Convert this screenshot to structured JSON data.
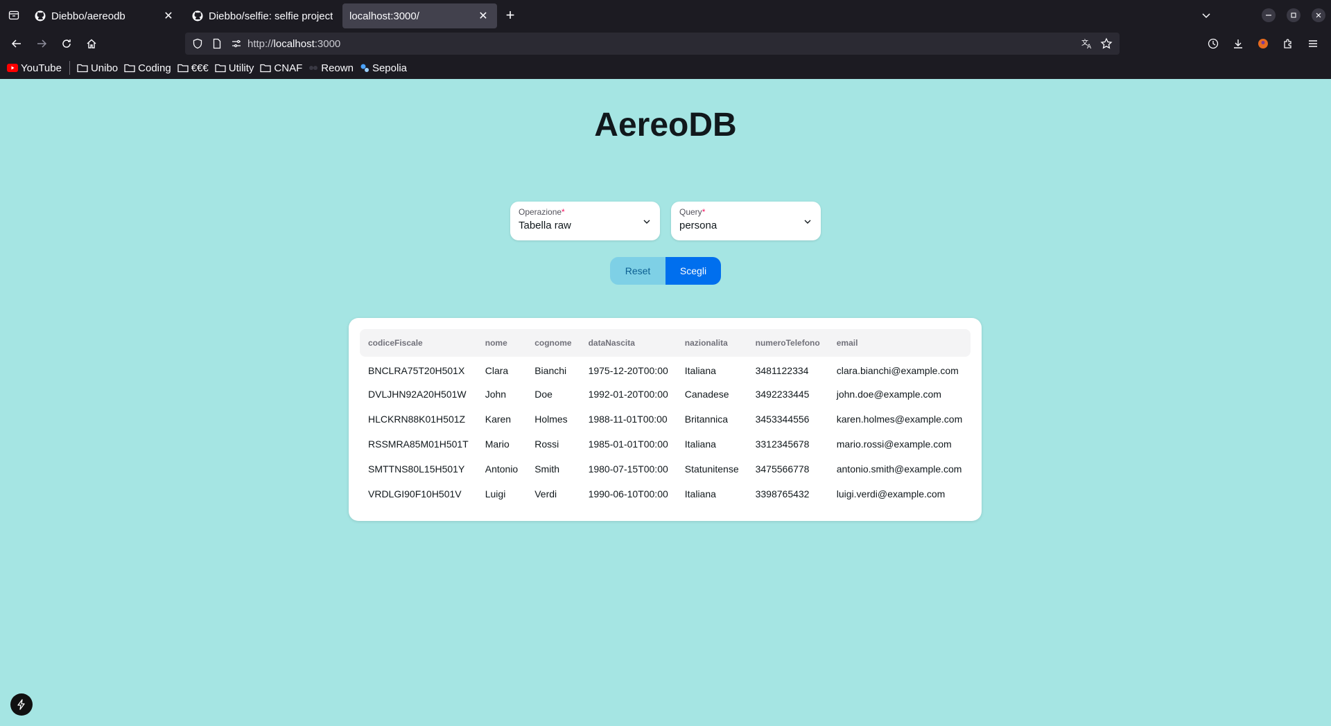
{
  "browser": {
    "tabs": [
      {
        "title": "Diebbo/aereodb",
        "icon": "github-icon"
      },
      {
        "title": "Diebbo/selfie: selfie project",
        "icon": "github-icon"
      },
      {
        "title": "localhost:3000/",
        "icon": ""
      }
    ],
    "url_prefix": "http://",
    "url_host": "localhost",
    "url_suffix": ":3000",
    "bookmarks": [
      {
        "label": "YouTube",
        "icon": "youtube-icon"
      },
      {
        "label": "Unibo",
        "icon": "folder-icon"
      },
      {
        "label": "Coding",
        "icon": "folder-icon"
      },
      {
        "label": "€€€",
        "icon": "folder-icon"
      },
      {
        "label": "Utility",
        "icon": "folder-icon"
      },
      {
        "label": "CNAF",
        "icon": "folder-icon"
      },
      {
        "label": "Reown",
        "icon": "reown-icon"
      },
      {
        "label": "Sepolia",
        "icon": "sepolia-icon"
      }
    ]
  },
  "page": {
    "title": "AereoDB",
    "operation_select": {
      "label": "Operazione",
      "required_mark": "*",
      "value": "Tabella raw"
    },
    "query_select": {
      "label": "Query",
      "required_mark": "*",
      "value": "persona"
    },
    "reset_label": "Reset",
    "choose_label": "Scegli",
    "table": {
      "columns": [
        "codiceFiscale",
        "nome",
        "cognome",
        "dataNascita",
        "nazionalita",
        "numeroTelefono",
        "email"
      ],
      "rows": [
        [
          "BNCLRA75T20H501X",
          "Clara",
          "Bianchi",
          "1975-12-20T00:00",
          "Italiana",
          "3481122334",
          "clara.bianchi@example.com"
        ],
        [
          "DVLJHN92A20H501W",
          "John",
          "Doe",
          "1992-01-20T00:00",
          "Canadese",
          "3492233445",
          "john.doe@example.com"
        ],
        [
          "HLCKRN88K01H501Z",
          "Karen",
          "Holmes",
          "1988-11-01T00:00",
          "Britannica",
          "3453344556",
          "karen.holmes@example.com"
        ],
        [
          "RSSMRA85M01H501T",
          "Mario",
          "Rossi",
          "1985-01-01T00:00",
          "Italiana",
          "3312345678",
          "mario.rossi@example.com"
        ],
        [
          "SMTTNS80L15H501Y",
          "Antonio",
          "Smith",
          "1980-07-15T00:00",
          "Statunitense",
          "3475566778",
          "antonio.smith@example.com"
        ],
        [
          "VRDLGI90F10H501V",
          "Luigi",
          "Verdi",
          "1990-06-10T00:00",
          "Italiana",
          "3398765432",
          "luigi.verdi@example.com"
        ]
      ]
    }
  },
  "colors": {
    "page_bg": "#a5e5e3",
    "primary": "#006fee",
    "reset_bg": "#7ed0e6",
    "chrome_bg": "#1c1b22"
  }
}
